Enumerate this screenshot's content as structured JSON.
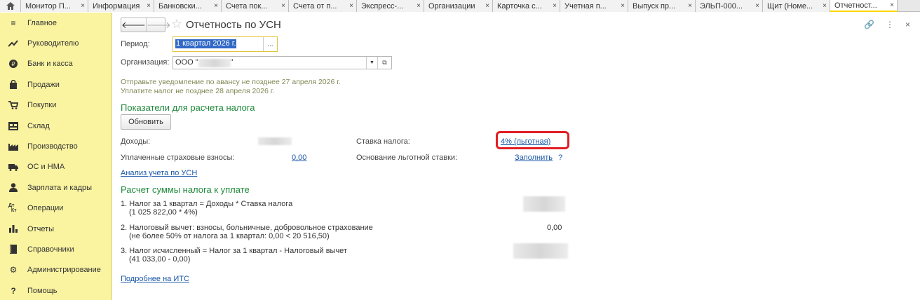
{
  "tabs": {
    "home_icon": "home-icon",
    "items": [
      {
        "label": "Монитор П..."
      },
      {
        "label": "Информация"
      },
      {
        "label": "Банковски..."
      },
      {
        "label": "Счета пок..."
      },
      {
        "label": "Счета от п..."
      },
      {
        "label": "Экспресс-..."
      },
      {
        "label": "Организации"
      },
      {
        "label": "Карточка с..."
      },
      {
        "label": "Учетная п..."
      },
      {
        "label": "Выпуск пр..."
      },
      {
        "label": "ЭЛЬП-000..."
      },
      {
        "label": "Щит (Номе..."
      },
      {
        "label": "Отчетност..."
      }
    ],
    "close_glyph": "×"
  },
  "sidebar": {
    "items": [
      {
        "label": "Главное",
        "icon": "menu-icon"
      },
      {
        "label": "Руководителю",
        "icon": "trend-icon"
      },
      {
        "label": "Банк и касса",
        "icon": "coin-icon"
      },
      {
        "label": "Продажи",
        "icon": "bag-icon"
      },
      {
        "label": "Покупки",
        "icon": "cart-icon"
      },
      {
        "label": "Склад",
        "icon": "warehouse-icon"
      },
      {
        "label": "Производство",
        "icon": "factory-icon"
      },
      {
        "label": "ОС и НМА",
        "icon": "truck-icon"
      },
      {
        "label": "Зарплата и кадры",
        "icon": "person-icon"
      },
      {
        "label": "Операции",
        "icon": "dt-kt-icon"
      },
      {
        "label": "Отчеты",
        "icon": "bar-chart-icon"
      },
      {
        "label": "Справочники",
        "icon": "book-icon"
      },
      {
        "label": "Администрирование",
        "icon": "gear-icon"
      },
      {
        "label": "Помощь",
        "icon": "help-icon"
      }
    ]
  },
  "header": {
    "title": "Отчетность по УСН",
    "back": "🡐",
    "forward": "🡒"
  },
  "form": {
    "period_label": "Период:",
    "period_value": "1 квартал 2026 г.",
    "period_btn": "...",
    "org_label": "Организация:",
    "org_prefix": "ООО \"",
    "org_suffix": "\"",
    "notice_1": "Отправьте уведомление по авансу не позднее 27 апреля 2026 г.",
    "notice_2": "Уплатите налог не позднее 28 апреля 2026 г."
  },
  "indicators": {
    "section_title": "Показатели для расчета налога",
    "refresh_button": "Обновить",
    "income_label": "Доходы:",
    "insurance_label": "Уплаченные страховые взносы:",
    "insurance_value": "0,00",
    "rate_label": "Ставка налога:",
    "rate_value": "4% (льготная)",
    "basis_label": "Основание льготной ставки:",
    "basis_link": "Заполнить",
    "help_mark": "?",
    "analysis_link": "Анализ учета по УСН"
  },
  "calculation": {
    "section_title": "Расчет суммы налога к уплате",
    "rows": [
      {
        "num": "1.",
        "line1": "Налог за 1 квартал = Доходы * Ставка налога",
        "line2": "(1 025 822,00 * 4%)",
        "value": ""
      },
      {
        "num": "2.",
        "line1": "Налоговый вычет: взносы, больничные, добровольное страхование",
        "line2": "(не более 50% от налога за 1 квартал: 0,00 < 20 516,50)",
        "value": "0,00"
      },
      {
        "num": "3.",
        "line1": "Налог исчисленный = Налог за 1 квартал - Налоговый вычет",
        "line2": "(41 033,00 - 0,00)",
        "value": ""
      }
    ],
    "its_link": "Подробнее на ИТС"
  }
}
